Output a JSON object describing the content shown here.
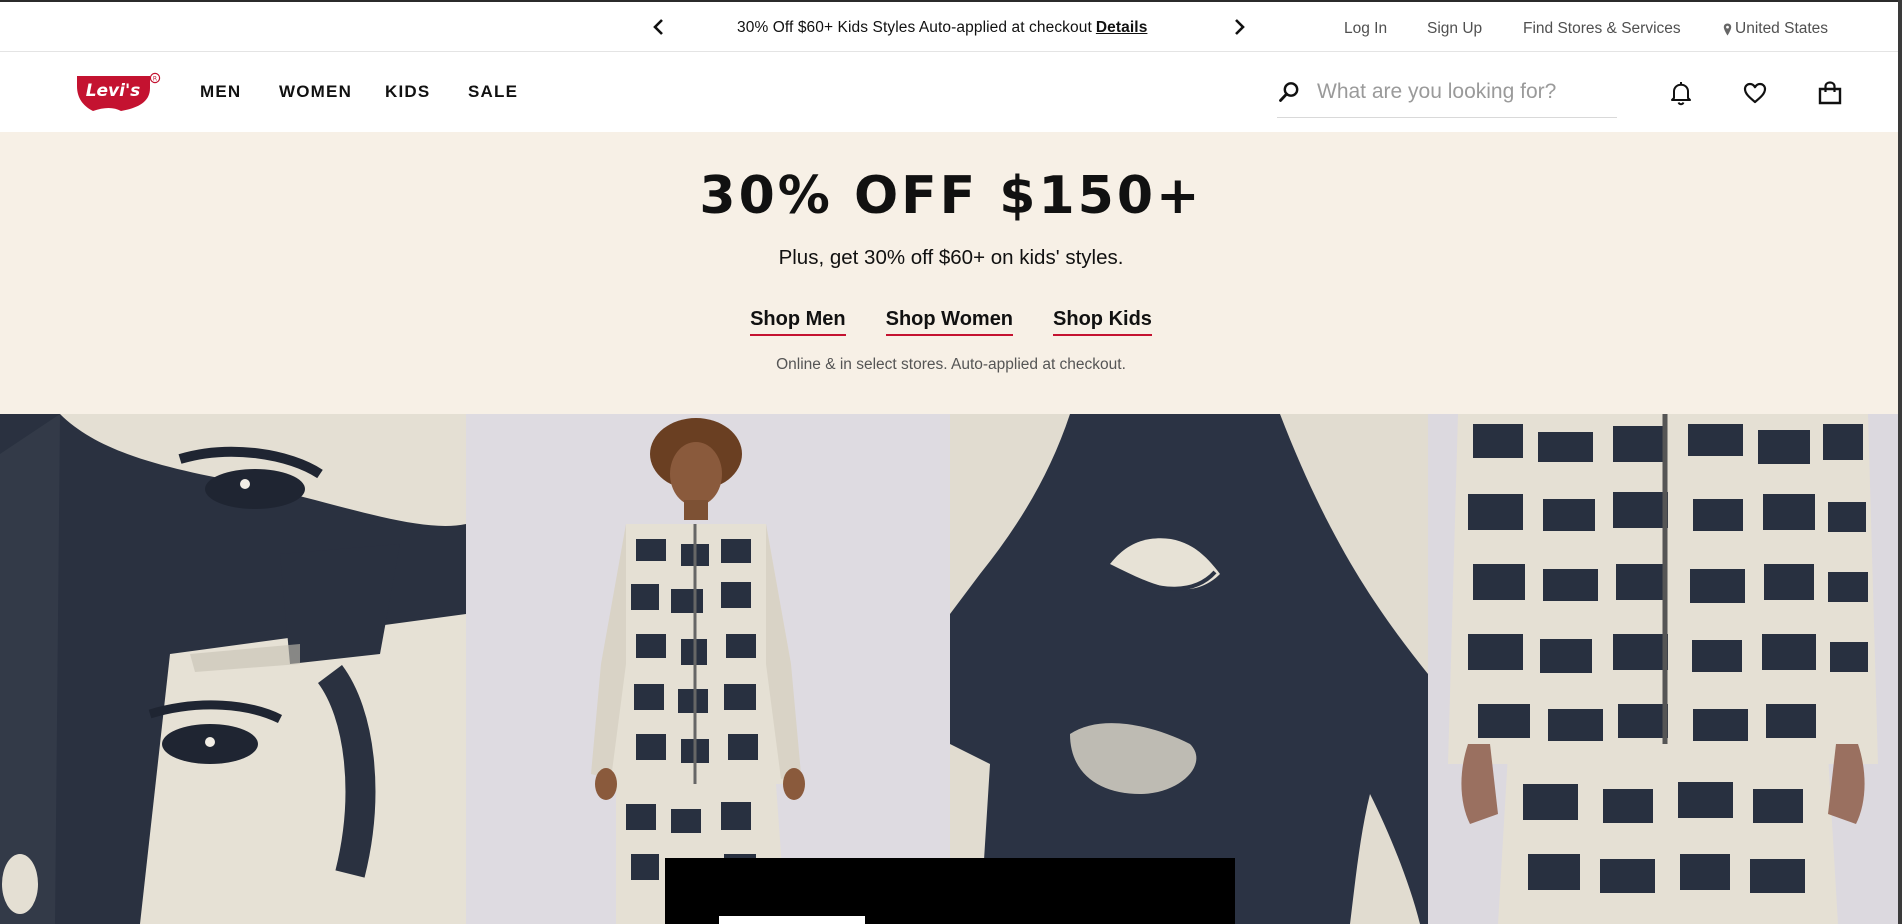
{
  "promo_bar": {
    "text": "30% Off $60+ Kids Styles Auto-applied at checkout",
    "details_link": "Details",
    "prev_icon": "chevron-left-icon",
    "next_icon": "chevron-right-icon"
  },
  "utility_links": {
    "login": "Log In",
    "signup": "Sign Up",
    "stores": "Find Stores & Services",
    "country": "United States",
    "country_icon": "location-pin-icon"
  },
  "nav": {
    "logo_text": "Levi's",
    "items": [
      "MEN",
      "WOMEN",
      "KIDS",
      "SALE"
    ]
  },
  "search": {
    "placeholder": "What are you looking for?",
    "value": ""
  },
  "header_icons": [
    "bell-icon",
    "heart-icon",
    "shopping-bag-icon"
  ],
  "hero": {
    "title": "30% OFF $150+",
    "subtitle": "Plus, get 30% off $60+ on kids' styles.",
    "links": [
      "Shop Men",
      "Shop Women",
      "Shop Kids"
    ],
    "note": "Online & in select stores. Auto-applied at checkout."
  },
  "colors": {
    "brand_red": "#c41230",
    "hero_bg": "#f7f0e6",
    "print_navy": "#2b3344",
    "print_cream": "#e7e2d6"
  }
}
